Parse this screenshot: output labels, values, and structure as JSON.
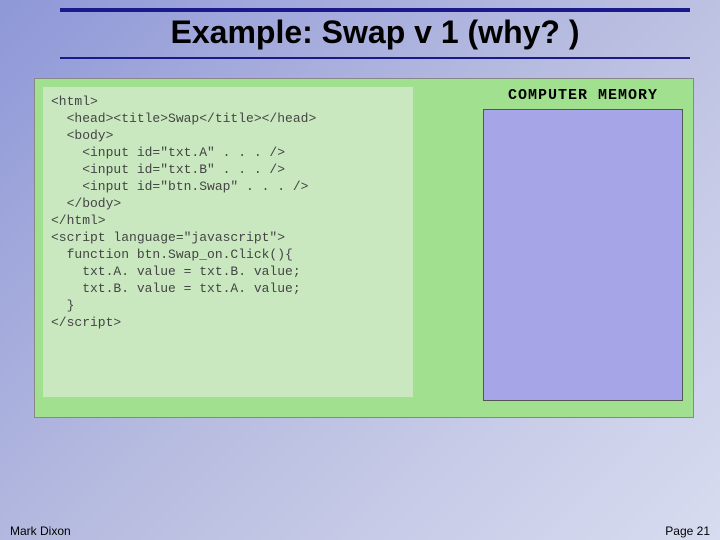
{
  "slide": {
    "title": "Example: Swap v 1 (why? )",
    "memory_label": "COMPUTER MEMORY"
  },
  "code": {
    "lines": [
      "<html>",
      "  <head><title>Swap</title></head>",
      "  <body>",
      "    <input id=\"txt.A\" . . . />",
      "    <input id=\"txt.B\" . . . />",
      "    <input id=\"btn.Swap\" . . . />",
      "  </body>",
      "</html>",
      "",
      "",
      "<script language=\"javascript\">",
      "  function btn.Swap_on.Click(){",
      "    txt.A. value = txt.B. value;",
      "    txt.B. value = txt.A. value;",
      "  }",
      "</script>"
    ]
  },
  "footer": {
    "author": "Mark Dixon",
    "page": "Page 21"
  }
}
